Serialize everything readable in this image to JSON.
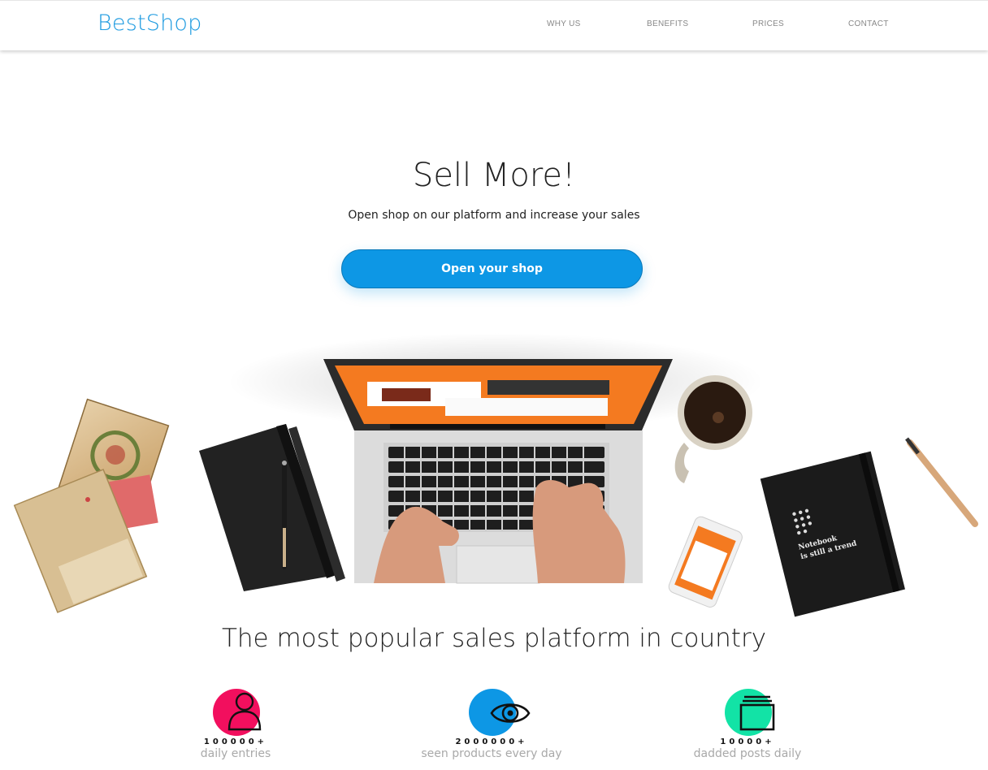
{
  "header": {
    "logo": "BestShop",
    "nav": [
      "WHY US",
      "BENEFITS",
      "PRICES",
      "CONTACT"
    ]
  },
  "hero": {
    "title": "Sell More!",
    "subtitle": "Open shop on our platform and increase your sales",
    "cta_label": "Open your shop"
  },
  "illustration": {
    "notebook_caption_line1": "Notebook",
    "notebook_caption_line2": "is still a trend"
  },
  "section": {
    "title": "The most popular sales platform in country",
    "stats": [
      {
        "icon": "user-icon",
        "color": "#f20f5e",
        "number": "100000+",
        "label": "daily entries"
      },
      {
        "icon": "eye-icon",
        "color": "#0d97e5",
        "number": "2000000+",
        "label": "seen products every day"
      },
      {
        "icon": "layers-icon",
        "color": "#12e3a6",
        "number": "10000+",
        "label": "dadded posts daily"
      }
    ]
  },
  "colors": {
    "brand": "#1c9ae0",
    "cta": "#0d97e5"
  }
}
